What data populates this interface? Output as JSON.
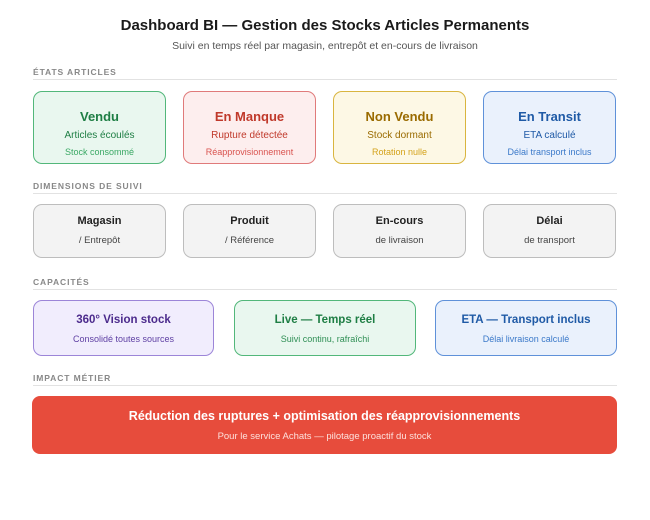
{
  "header": {
    "title": "Dashboard BI — Gestion des Stocks Articles Permanents",
    "subtitle": "Suivi en temps réel par magasin, entrepôt et en-cours de livraison"
  },
  "sections": {
    "etats": "ÉTATS ARTICLES",
    "dimensions": "DIMENSIONS DE SUIVI",
    "capacites": "CAPACITÉS",
    "impact": "IMPACT MÉTIER"
  },
  "etats": [
    {
      "title": "Vendu",
      "line2": "Articles écoulés",
      "line3": "Stock consommé",
      "color": "#1e7e44",
      "bg": "#e9f7ef",
      "border": "#52b77a",
      "sub": "#3aa864"
    },
    {
      "title": "En Manque",
      "line2": "Rupture détectée",
      "line3": "Réapprovisionnement",
      "color": "#c0392b",
      "bg": "#fdeeee",
      "border": "#e07a7a",
      "sub": "#d9534f"
    },
    {
      "title": "Non Vendu",
      "line2": "Stock dormant",
      "line3": "Rotation nulle",
      "color": "#9a6b00",
      "bg": "#fdf8e5",
      "border": "#d9b53f",
      "sub": "#d4a21a"
    },
    {
      "title": "En Transit",
      "line2": "ETA calculé",
      "line3": "Délai transport inclus",
      "color": "#1f5aa6",
      "bg": "#eaf1fc",
      "border": "#5f91d9",
      "sub": "#3b79c9"
    }
  ],
  "dimensions": [
    {
      "line1": "Magasin",
      "line2": "/ Entrepôt"
    },
    {
      "line1": "Produit",
      "line2": "/ Référence"
    },
    {
      "line1": "En-cours",
      "line2": "de livraison"
    },
    {
      "line1": "Délai",
      "line2": "de transport"
    }
  ],
  "capacites": [
    {
      "title": "360° Vision stock",
      "desc": "Consolidé toutes sources",
      "color": "#4b2a8c",
      "bg": "#f1edfd",
      "border": "#9c85d8",
      "sub": "#5e3fa3"
    },
    {
      "title": "Live — Temps réel",
      "desc": "Suivi continu, rafraîchi",
      "color": "#1e7e44",
      "bg": "#e9f7ef",
      "border": "#52b77a",
      "sub": "#2f8f55"
    },
    {
      "title": "ETA — Transport inclus",
      "desc": "Délai livraison calculé",
      "color": "#1f5aa6",
      "bg": "#eaf1fc",
      "border": "#5f91d9",
      "sub": "#3b79c9"
    }
  ],
  "impact": {
    "title": "Réduction des ruptures + optimisation des réapprovisionnements",
    "subtitle": "Pour le service Achats — pilotage proactif du stock",
    "color": "#e74c3c"
  }
}
